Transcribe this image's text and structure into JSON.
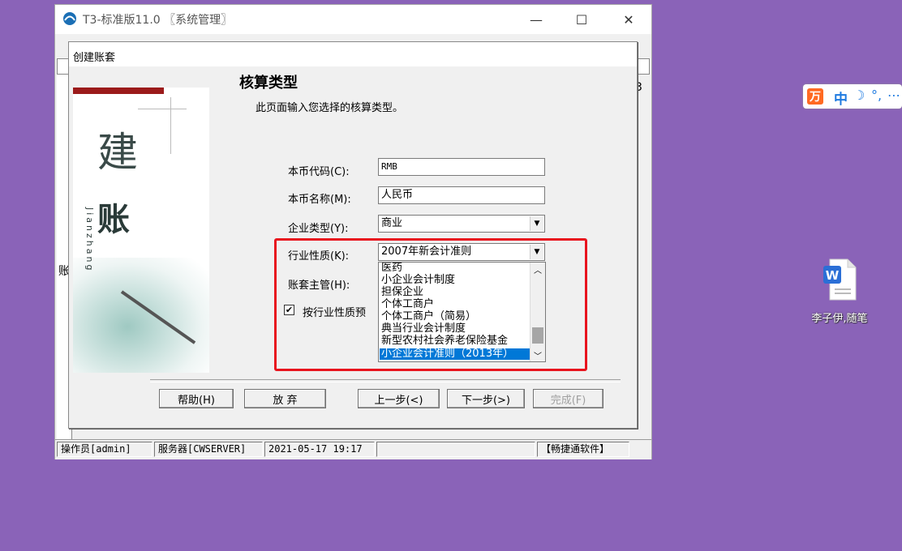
{
  "app": {
    "title": "T3-标准版11.0 〖系统管理〗",
    "window_controls": {
      "minimize": "—",
      "maximize": "☐",
      "close": "✕"
    },
    "behind_glyph_right": "3",
    "behind_glyph_left": "账"
  },
  "dialog": {
    "title": "创建账套",
    "banner": {
      "char1": "建",
      "char2": "账",
      "pinyin": "Jianzhang"
    },
    "section_title": "核算类型",
    "section_desc": "此页面输入您选择的核算类型。",
    "fields": {
      "currency_code": {
        "label": "本币代码(C):",
        "value": "RMB"
      },
      "currency_name": {
        "label": "本币名称(M):",
        "value": "人民币"
      },
      "enterprise_type": {
        "label": "企业类型(Y):",
        "value": "商业"
      },
      "industry_nature": {
        "label": "行业性质(K):",
        "value": "2007年新会计准则"
      },
      "account_manager": {
        "label": "账套主管(H):"
      }
    },
    "industry_options": [
      "医药",
      "小企业会计制度",
      "担保企业",
      "个体工商户",
      "个体工商户（简易）",
      "典当行业会计制度",
      "新型农村社会养老保险基金",
      "小企业会计准则（2013年）"
    ],
    "selected_option_index": 7,
    "checkbox": {
      "label": "按行业性质预",
      "checked": true,
      "mark": "✔"
    },
    "buttons": {
      "help": "帮助(H)",
      "discard": "放 弃",
      "prev": "上一步(<)",
      "next": "下一步(>)",
      "finish": "完成(F)"
    }
  },
  "statusbar": {
    "operator": "操作员[admin]",
    "server": "服务器[CWSERVER]",
    "datetime": "2021-05-17 19:17",
    "empty": "",
    "company": "【畅捷通软件】"
  },
  "ime": {
    "logo": "万",
    "mode": "中",
    "moon": "☽",
    "dots": "°,",
    "more": "⋯"
  },
  "desktop": {
    "icon_label": "李子伊,随笔",
    "icon_badge": "W"
  },
  "colors": {
    "desktop": "#8a63b8",
    "highlight": "#e8141e",
    "selection": "#0078d7",
    "banner_bar": "#9b1b1b"
  }
}
